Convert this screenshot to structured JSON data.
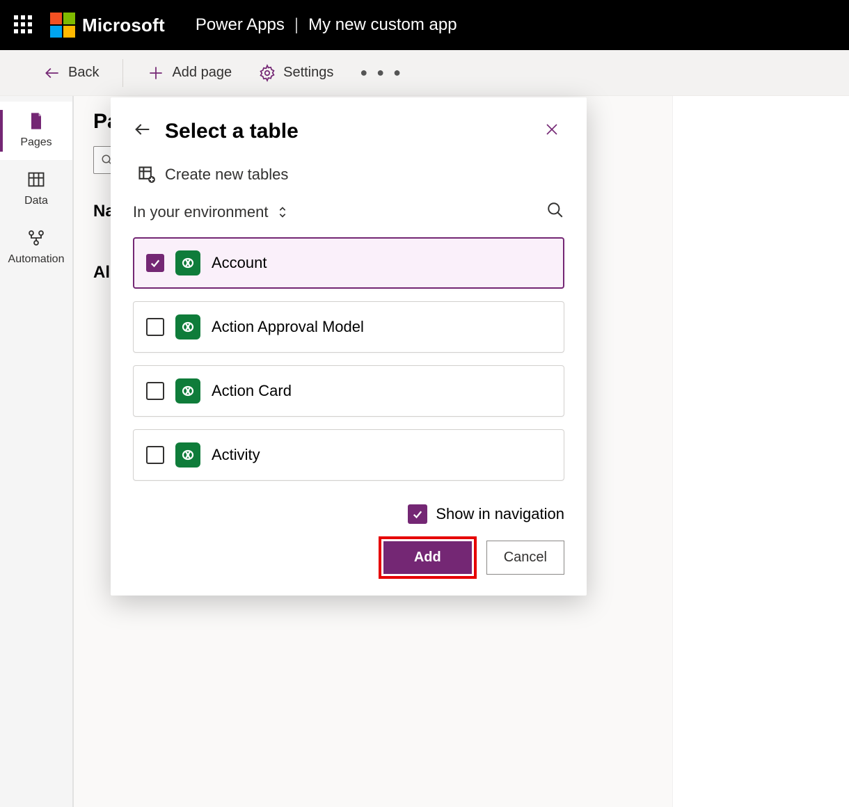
{
  "topbar": {
    "brand": "Microsoft",
    "product": "Power Apps",
    "app_name": "My new custom app"
  },
  "toolbar": {
    "back": "Back",
    "add_page": "Add page",
    "settings": "Settings"
  },
  "leftrail": {
    "items": [
      {
        "label": "Pages"
      },
      {
        "label": "Data"
      },
      {
        "label": "Automation"
      }
    ]
  },
  "content": {
    "heading_partial_1": "Pa",
    "section_nav_partial": "Na",
    "section_all_partial": "Al"
  },
  "modal": {
    "title": "Select a table",
    "create_new": "Create new tables",
    "filter_label": "In your environment",
    "tables": [
      {
        "name": "Account",
        "selected": true
      },
      {
        "name": "Action Approval Model",
        "selected": false
      },
      {
        "name": "Action Card",
        "selected": false
      },
      {
        "name": "Activity",
        "selected": false
      }
    ],
    "show_in_nav": "Show in navigation",
    "add": "Add",
    "cancel": "Cancel"
  }
}
